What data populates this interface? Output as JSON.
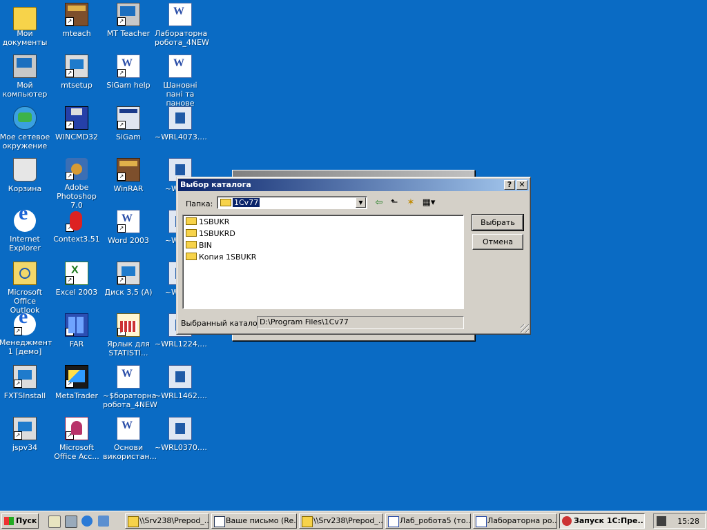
{
  "desktop": {
    "icons": [
      {
        "label": "Мои документы",
        "icon": "my-documents-icon"
      },
      {
        "label": "mteach",
        "icon": "winrar-archive-icon"
      },
      {
        "label": "MT Teacher",
        "icon": "mt-teacher-icon"
      },
      {
        "label": "Лабораторна робота_4NEW",
        "icon": "word-document-icon"
      },
      {
        "label": "Мой компьютер",
        "icon": "my-computer-icon"
      },
      {
        "label": "mtsetup",
        "icon": "setup-icon"
      },
      {
        "label": "SiGam help",
        "icon": "word-document-icon"
      },
      {
        "label": "Шановні пані та панове",
        "icon": "word-document-icon"
      },
      {
        "label": "Мое сетевое окружение",
        "icon": "network-icon"
      },
      {
        "label": "WINCMD32",
        "icon": "floppy-icon"
      },
      {
        "label": "SiGam",
        "icon": "sigam-icon"
      },
      {
        "label": "~WRL4073....",
        "icon": "wrl-file-icon"
      },
      {
        "label": "Корзина",
        "icon": "recycle-bin-icon"
      },
      {
        "label": "Adobe Photoshop 7.0",
        "icon": "photoshop-icon"
      },
      {
        "label": "WinRAR",
        "icon": "winrar-icon"
      },
      {
        "label": "~WRL...",
        "icon": "wrl-file-icon"
      },
      {
        "label": "Internet Explorer",
        "icon": "internet-explorer-icon"
      },
      {
        "label": "Context3.51",
        "icon": "context-parrot-icon"
      },
      {
        "label": "Word 2003",
        "icon": "word-icon"
      },
      {
        "label": "~WRL...",
        "icon": "wrl-file-icon"
      },
      {
        "label": "Microsoft Office Outlook",
        "icon": "outlook-icon"
      },
      {
        "label": "Excel 2003",
        "icon": "excel-icon"
      },
      {
        "label": "Диск 3,5 (A)",
        "icon": "floppy-drive-icon"
      },
      {
        "label": "~WRL...",
        "icon": "wrl-file-icon"
      },
      {
        "label": "Менеджмент 1 [демо]",
        "icon": "management-icon"
      },
      {
        "label": "FAR",
        "icon": "far-icon"
      },
      {
        "label": "Ярлык для STATISTI...",
        "icon": "statistica-icon"
      },
      {
        "label": "~WRL1224....",
        "icon": "wrl-file-icon"
      },
      {
        "label": "FXTSInstall",
        "icon": "setup-icon"
      },
      {
        "label": "MetaTrader",
        "icon": "metatrader-icon"
      },
      {
        "label": "~$бораторна робота_4NEW",
        "icon": "word-temp-icon"
      },
      {
        "label": "~WRL1462....",
        "icon": "wrl-file-icon"
      },
      {
        "label": "jspv34",
        "icon": "setup-icon"
      },
      {
        "label": "Microsoft Office Acc...",
        "icon": "access-icon"
      },
      {
        "label": "Основи використан...",
        "icon": "word-document-icon"
      },
      {
        "label": "~WRL0370....",
        "icon": "wrl-file-icon"
      }
    ]
  },
  "dialog": {
    "title": "Выбор каталога",
    "help_glyph": "?",
    "close_glyph": "✕",
    "folder_label": "Папка:",
    "folder_value": "1Cv77",
    "toolbar": {
      "back": "⇦",
      "up": "⬑",
      "new_folder": "✶",
      "view": "▦▾"
    },
    "items": [
      "1SBUKR",
      "1SBUKRD",
      "BIN",
      "Копия 1SBUKR"
    ],
    "select_button": "Выбрать",
    "cancel_button": "Отмена",
    "selected_label": "Выбранный каталог:",
    "selected_value": "D:\\Program Files\\1Cv77"
  },
  "taskbar": {
    "start_label": "Пуск",
    "tasks": [
      {
        "label": "\\\\Srv238\\Prepod_...",
        "icon": "folder-icon"
      },
      {
        "label": "Ваше письмо (Re...",
        "icon": "outlook-mail-icon"
      },
      {
        "label": "\\\\Srv238\\Prepod_...",
        "icon": "folder-icon"
      },
      {
        "label": "Лаб_робота5 (то...",
        "icon": "word-document-icon"
      },
      {
        "label": "Лабораторна ро...",
        "icon": "word-document-icon"
      },
      {
        "label": "Запуск 1С:Пре...",
        "icon": "1c-icon",
        "active": true
      }
    ],
    "clock": "15:28"
  }
}
